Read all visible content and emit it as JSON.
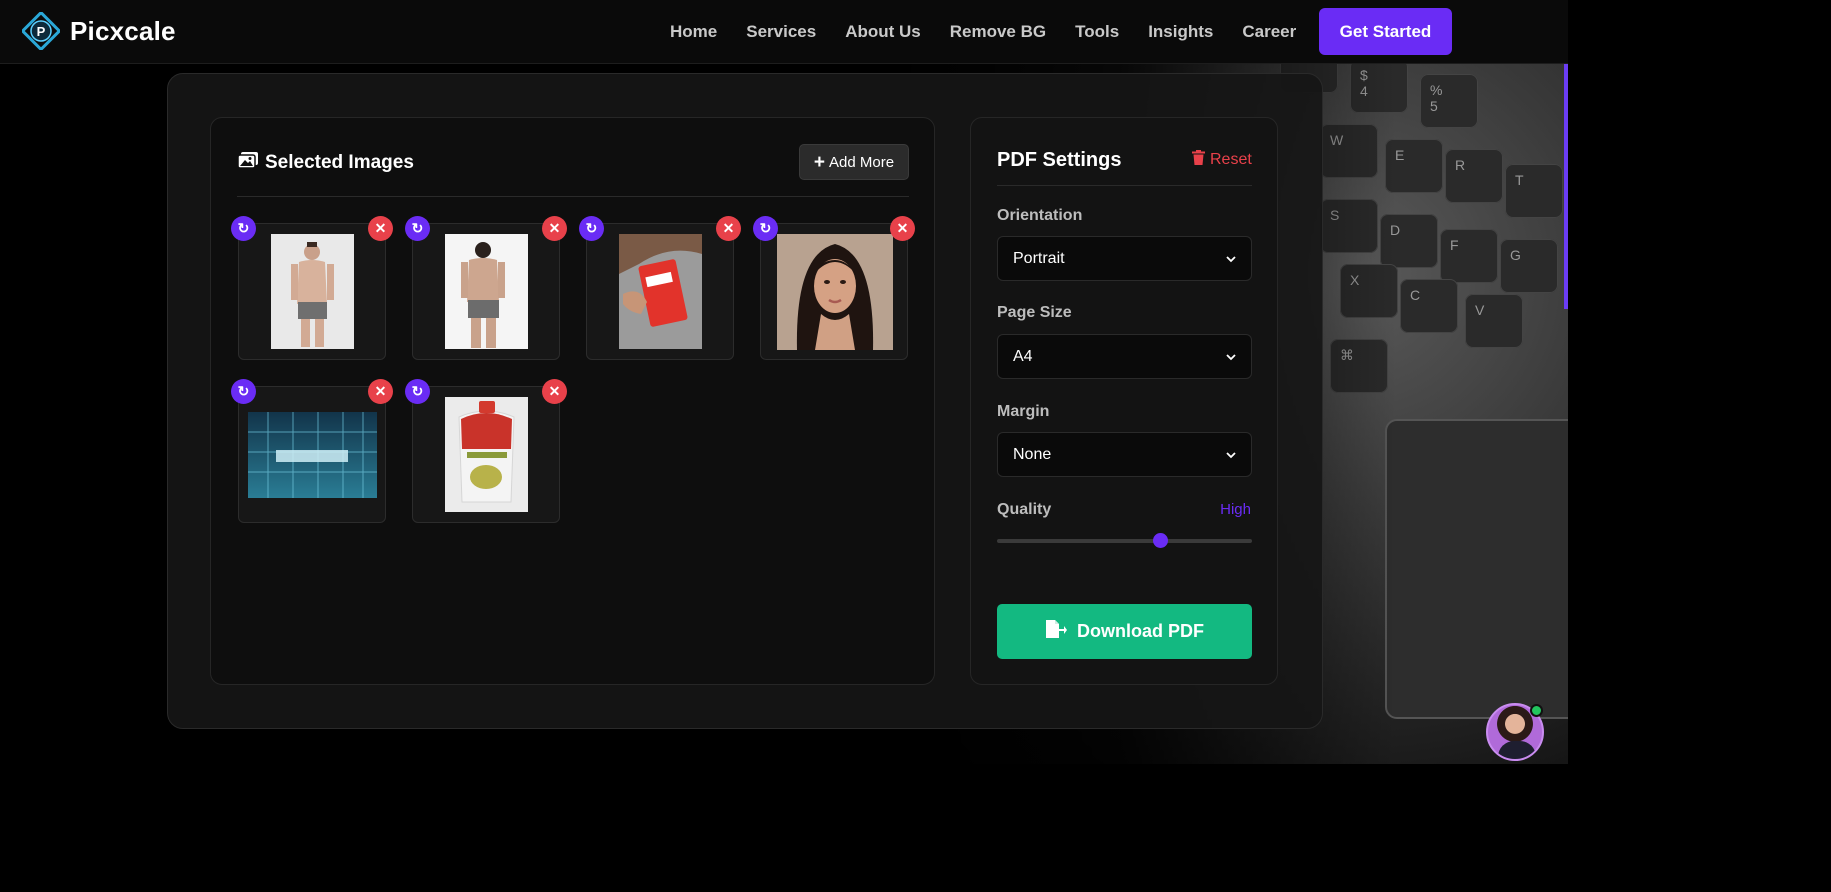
{
  "brand": {
    "name": "Picxcale"
  },
  "nav": {
    "links": [
      "Home",
      "Services",
      "About Us",
      "Remove BG",
      "Tools",
      "Insights",
      "Career"
    ],
    "cta": "Get Started"
  },
  "images_panel": {
    "title": "Selected Images",
    "add_more": "Add More",
    "thumbnails": [
      {
        "name": "model-front-photo"
      },
      {
        "name": "model-back-photo"
      },
      {
        "name": "red-package-photo"
      },
      {
        "name": "woman-portrait-photo"
      },
      {
        "name": "picxcale-building-photo"
      },
      {
        "name": "sauce-pouch-photo"
      }
    ]
  },
  "settings": {
    "title": "PDF Settings",
    "reset": "Reset",
    "orientation": {
      "label": "Orientation",
      "value": "Portrait"
    },
    "page_size": {
      "label": "Page Size",
      "value": "A4"
    },
    "margin": {
      "label": "Margin",
      "value": "None"
    },
    "quality": {
      "label": "Quality",
      "value": "High",
      "level": 0.65
    },
    "download": "Download PDF"
  },
  "colors": {
    "accent": "#6a2cf5",
    "danger": "#e8414a",
    "success": "#13b981"
  }
}
